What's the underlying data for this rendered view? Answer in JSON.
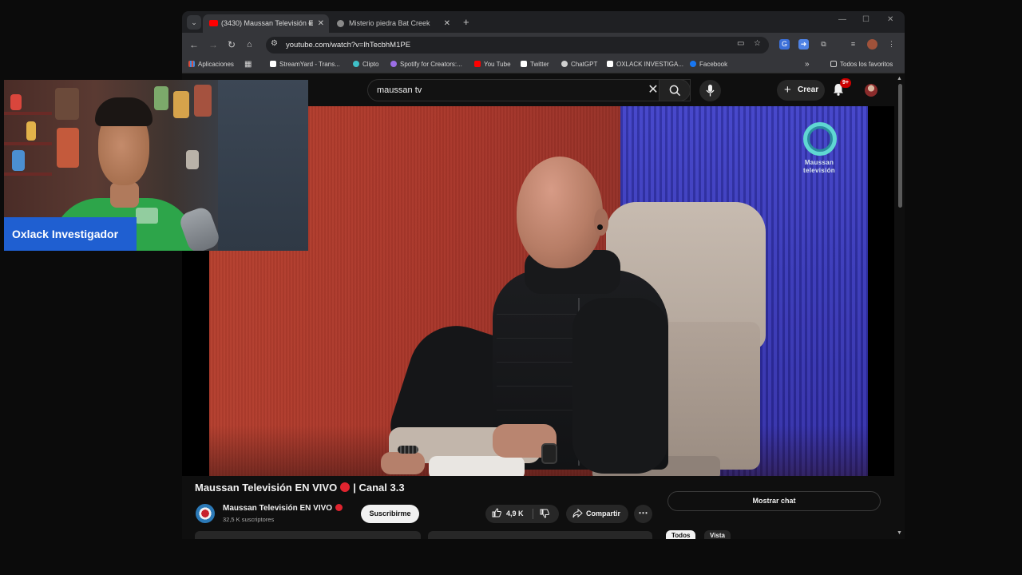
{
  "browser": {
    "tabs": [
      {
        "label": "(3430) Maussan Televisión E",
        "active": true,
        "favicon": "youtube-icon",
        "audio": true
      },
      {
        "label": "Misterio piedra Bat Creek",
        "active": false,
        "favicon": "globe-icon"
      }
    ],
    "url": "youtube.com/watch?v=lhTecbhM1PE",
    "bookmarks": [
      {
        "label": "Aplicaciones",
        "icon": "apps-grid-icon"
      },
      {
        "label": "StreamYard - Trans...",
        "icon": "streamyard-icon"
      },
      {
        "label": "Clipto",
        "icon": "clipto-icon"
      },
      {
        "label": "Spotify for Creators:...",
        "icon": "spotify-icon"
      },
      {
        "label": "You Tube",
        "icon": "youtube-icon"
      },
      {
        "label": "Twitter",
        "icon": "x-icon"
      },
      {
        "label": "ChatGPT",
        "icon": "chatgpt-icon"
      },
      {
        "label": "OXLACK INVESTIGA...",
        "icon": "tiktok-icon"
      },
      {
        "label": "Facebook",
        "icon": "facebook-icon"
      }
    ],
    "all_bookmarks": "Todos los favoritos"
  },
  "youtube": {
    "search_value": "maussan tv",
    "create_label": "Crear",
    "notifications_badge": "9+",
    "video_title": "Maussan Televisión EN VIVO",
    "video_title_suffix": "| Canal 3.3",
    "channel_name": "Maussan Televisión EN VIVO",
    "subscribers": "32,5 K suscriptores",
    "subscribe_label": "Suscribirme",
    "likes": "4,9 K",
    "share_label": "Compartir",
    "show_chat_label": "Mostrar chat",
    "chips": [
      "Todos",
      "Vista"
    ],
    "player_logo_line1": "Maussan",
    "player_logo_line2": "televisión"
  },
  "webcam": {
    "name_label": "Oxlack Investigador"
  },
  "colors": {
    "accent_red": "#e0242f",
    "youtube_red": "#cc0000",
    "webcam_label_blue": "#1f5fd1",
    "studio_red": "#b8412f",
    "studio_blue": "#3e3fc8"
  }
}
